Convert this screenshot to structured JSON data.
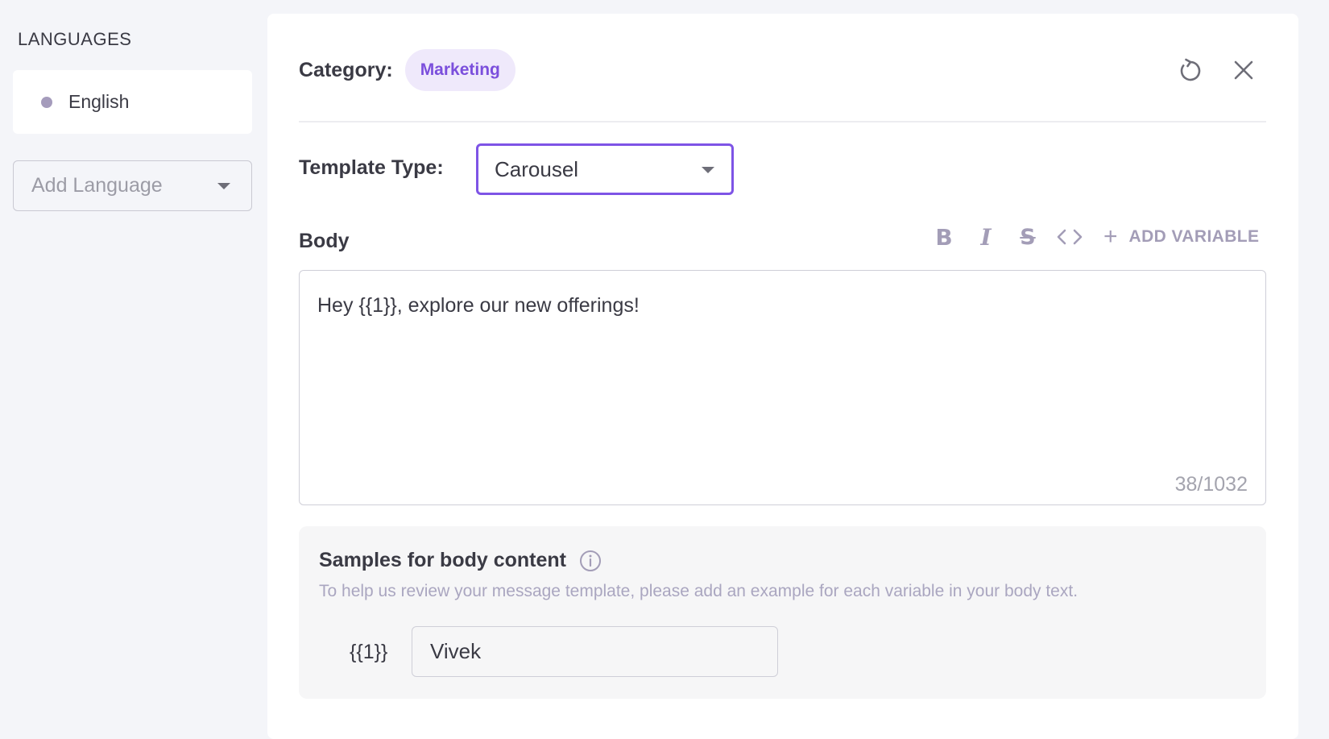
{
  "sidebar": {
    "heading": "LANGUAGES",
    "languages": [
      {
        "label": "English"
      }
    ],
    "add_language": {
      "placeholder": "Add Language"
    }
  },
  "header": {
    "category_label": "Category:",
    "category_value": "Marketing",
    "icons": [
      "refresh-icon",
      "close-icon"
    ]
  },
  "template_type": {
    "label": "Template Type:",
    "value": "Carousel"
  },
  "body": {
    "label": "Body",
    "toolbar": {
      "bold": "B",
      "italic": "I",
      "strike": "S",
      "code": "<>",
      "add_variable": "ADD VARIABLE"
    },
    "text": "Hey {{1}}, explore our new offerings!",
    "char_count": "38/1032"
  },
  "samples": {
    "title": "Samples for body content",
    "description": "To help us review your message template, please add an example for each variable in your body text.",
    "variables": [
      {
        "token": "{{1}}",
        "value": "Vivek"
      }
    ]
  },
  "colors": {
    "accent": "#7e54e6",
    "badge_bg": "#efe9fb",
    "badge_text": "#7b4fdc",
    "muted_icon": "#a39db7",
    "page_bg": "#f4f5f9"
  }
}
